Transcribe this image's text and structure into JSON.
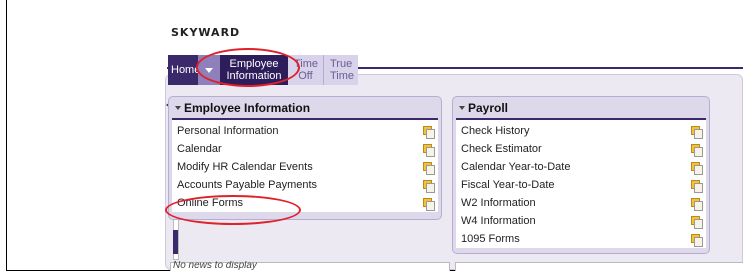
{
  "logo": "SKYWARD",
  "tabs": {
    "home": "Home",
    "employee_information_1": "Employee",
    "employee_information_2": "Information",
    "time_off_1": "Time",
    "time_off_2": "Off",
    "true_time_1": "True",
    "true_time_2": "Time"
  },
  "employee_panel": {
    "title": "Employee Information",
    "items": [
      "Personal Information",
      "Calendar",
      "Modify HR Calendar Events",
      "Accounts Payable Payments",
      "Online Forms"
    ]
  },
  "payroll_panel": {
    "title": "Payroll",
    "items": [
      "Check History",
      "Check Estimator",
      "Calendar Year-to-Date",
      "Fiscal Year-to-Date",
      "W2 Information",
      "W4 Information",
      "1095 Forms"
    ]
  },
  "news": "No news to display",
  "colors": {
    "brand_purple": "#3b2a6b",
    "annotation_red": "#e0202a",
    "favorite_icon": "#f2c23a"
  },
  "icons": [
    "dropdown-caret-icon",
    "favorite-icon",
    "collapse-triangle-icon",
    "side-nav-arrow-icon"
  ]
}
